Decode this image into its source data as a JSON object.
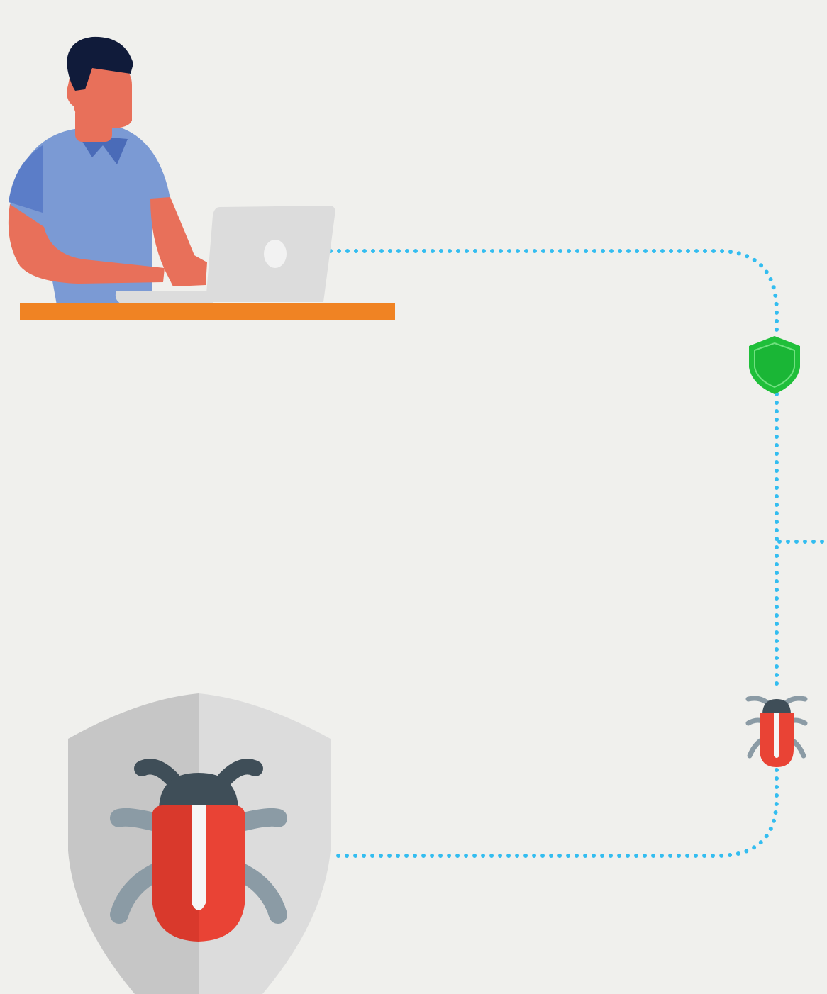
{
  "colors": {
    "background": "#f0f0ed",
    "connector": "#33bdf0",
    "secure_shield": "#1fbf3a",
    "desk": "#f08323",
    "shirt": "#7b9ad4",
    "skin": "#e8705a",
    "hair": "#101b3a",
    "laptop": "#dcdcdc",
    "bug_body": "#e94335",
    "bug_head": "#3f4e58",
    "bug_legs": "#8b9ba5",
    "shield_light": "#dcdcdc",
    "shield_dark": "#c6c6c6"
  },
  "icons": {
    "user": "person-at-laptop-icon",
    "secure": "green-shield-icon",
    "threat": "bug-icon",
    "antivirus": "shield-bug-icon"
  }
}
